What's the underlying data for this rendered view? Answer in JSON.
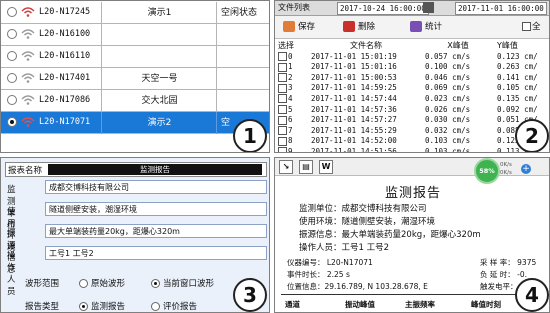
{
  "panel1": {
    "badge": "1",
    "rows": [
      {
        "device": "L20-N17245",
        "place": "演示1",
        "state": "空闲状态",
        "selected": false,
        "wifi_color": "#d23c3c"
      },
      {
        "device": "L20-N16100",
        "place": "",
        "state": "",
        "selected": false,
        "wifi_color": "#9a9a9a"
      },
      {
        "device": "L20-N16110",
        "place": "",
        "state": "",
        "selected": false,
        "wifi_color": "#9a9a9a"
      },
      {
        "device": "L20-N17401",
        "place": "天空一号",
        "state": "",
        "selected": false,
        "wifi_color": "#9a9a9a"
      },
      {
        "device": "L20-N17086",
        "place": "交大北园",
        "state": "",
        "selected": false,
        "wifi_color": "#9a9a9a"
      },
      {
        "device": "L20-N17071",
        "place": "演示2",
        "state": "空",
        "selected": true,
        "wifi_color": "#e05050"
      }
    ]
  },
  "panel2": {
    "badge": "2",
    "list_label": "文件列表",
    "date_from": "2017-10-24 16:00:00",
    "date_to": "2017-11-01 16:00:00",
    "select_all": "全",
    "toolbar": {
      "save": "保存",
      "delete": "删除",
      "stats": "统计"
    },
    "headers": [
      "选择",
      "文件名称",
      "X峰值",
      "Y峰值"
    ],
    "rows": [
      [
        "0",
        "2017-11-01 15:01:19",
        "0.057 cm/s",
        "0.123 cm/"
      ],
      [
        "1",
        "2017-11-01 15:01:16",
        "0.100 cm/s",
        "0.263 cm/"
      ],
      [
        "2",
        "2017-11-01 15:00:53",
        "0.046 cm/s",
        "0.141 cm/"
      ],
      [
        "3",
        "2017-11-01 14:59:25",
        "0.069 cm/s",
        "0.105 cm/"
      ],
      [
        "4",
        "2017-11-01 14:57:44",
        "0.023 cm/s",
        "0.135 cm/"
      ],
      [
        "5",
        "2017-11-01 14:57:36",
        "0.026 cm/s",
        "0.092 cm/"
      ],
      [
        "6",
        "2017-11-01 14:57:27",
        "0.030 cm/s",
        "0.051 cm/"
      ],
      [
        "7",
        "2017-11-01 14:55:29",
        "0.032 cm/s",
        "0.088 cm/"
      ],
      [
        "8",
        "2017-11-01 14:52:00",
        "0.103 cm/s",
        "0.123 cm/"
      ],
      [
        "9",
        "2017-11-01 14:51:56",
        "0.103 cm/s",
        "0.113 cm/"
      ]
    ]
  },
  "panel3": {
    "badge": "3",
    "report_name_label": "报表名称",
    "report_name_value": "监测报告",
    "fields": [
      {
        "label": "监测单位",
        "value": "成都交博科技有限公司"
      },
      {
        "label": "使用环境",
        "value": "隧道侧壁安装，潮湿环境"
      },
      {
        "label": "振源信息",
        "value": "最大单端装药量20kg，距爆心320m"
      },
      {
        "label": "操作人员",
        "value": "工号1 工号2"
      }
    ],
    "waveform_label": "波形范围",
    "waveform_opt1": "原始波形",
    "waveform_opt2": "当前窗口波形",
    "report_type_label": "报告类型",
    "report_type_opt1": "监测报告",
    "report_type_opt2": "评价报告"
  },
  "panel4": {
    "badge": "4",
    "gauge_pct": "58%",
    "speed_up": "0K/s",
    "speed_down": "0K/s",
    "title": "监测报告",
    "lines": [
      "监测单位：成都交博科技有限公司",
      "使用环境：隧道侧壁安装，潮湿环境",
      "振源信息：最大单端装药量20kg，距爆心320m",
      "操作人员：工号1 工号2"
    ],
    "device_no": "仪器编号：  L20-N17071",
    "event_len": "事件时长：  2.25 s",
    "position": "位置信息：29.16.789, N 103.28.678, E",
    "sample_rate": "采 样 率：  9375",
    "neg_delay": "负 延 时：  -0.",
    "trigger": "触发电平：  0.",
    "table_headers": [
      "通道",
      "振动峰值",
      "主振频率",
      "峰值时刻"
    ]
  }
}
